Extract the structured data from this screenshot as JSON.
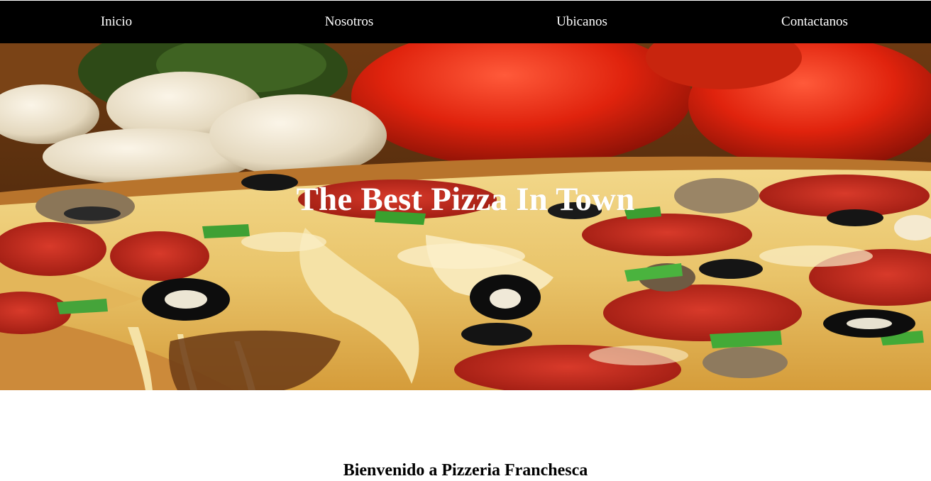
{
  "nav": {
    "items": [
      {
        "label": "Inicio"
      },
      {
        "label": "Nosotros"
      },
      {
        "label": "Ubicanos"
      },
      {
        "label": "Contactanos"
      }
    ]
  },
  "hero": {
    "title": "The Best Pizza In Town",
    "image": "pizza-photo"
  },
  "welcome": {
    "heading": "Bienvenido a Pizzeria Franchesca"
  },
  "colors": {
    "nav_background": "#000000",
    "nav_text": "#ffffff",
    "hero_text": "#ffffff",
    "page_background": "#ffffff"
  }
}
